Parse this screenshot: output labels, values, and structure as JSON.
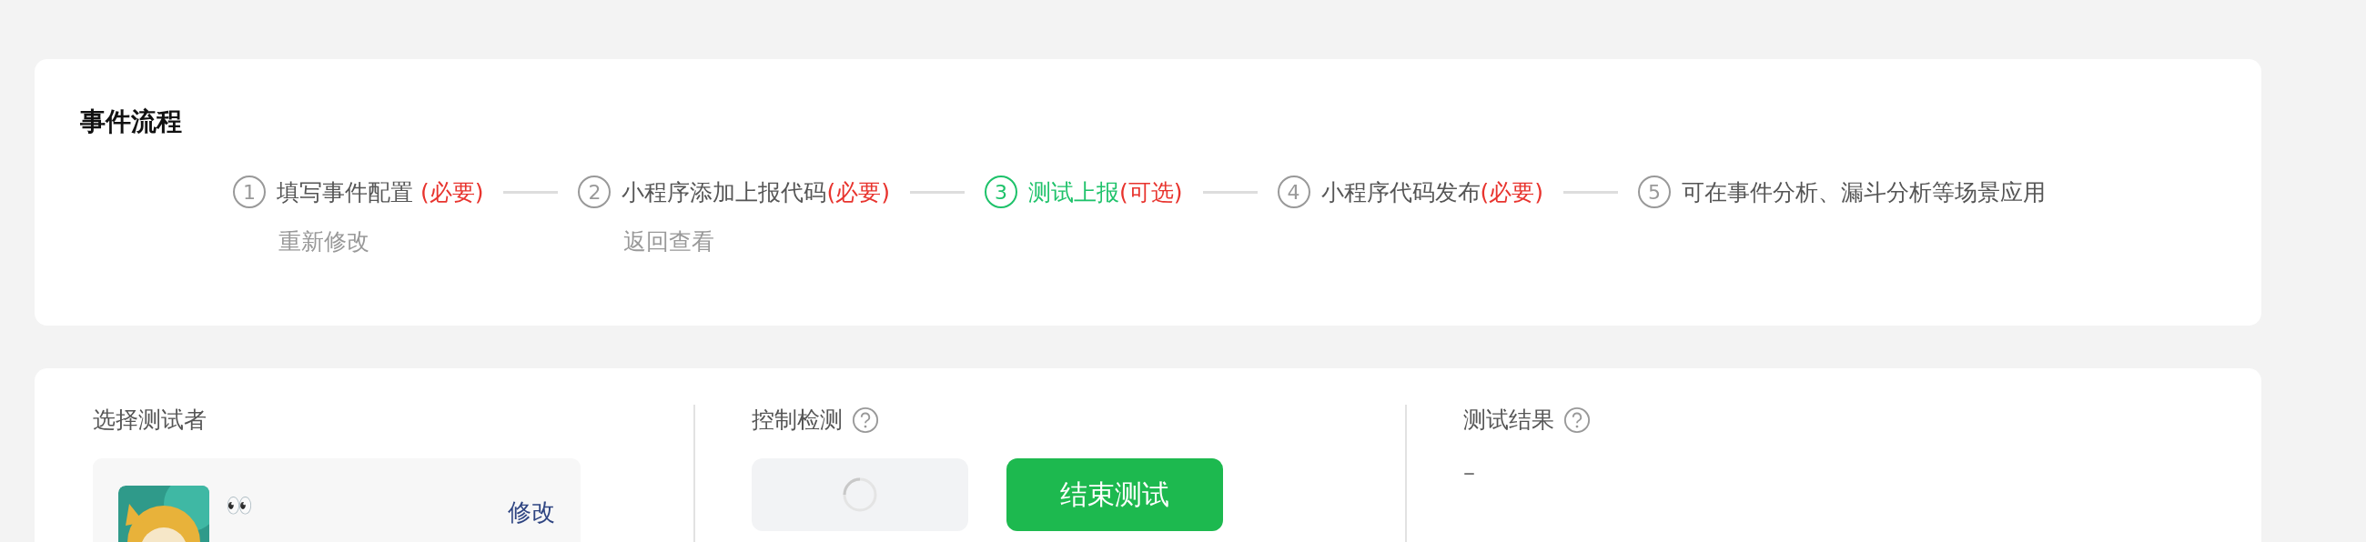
{
  "flow": {
    "title": "事件流程",
    "steps": [
      {
        "number": "1",
        "label": "填写事件配置 ",
        "tag": "(必要)",
        "selected": false,
        "link": "重新修改"
      },
      {
        "number": "2",
        "label": "小程序添加上报代码",
        "tag": "(必要)",
        "selected": false,
        "link": "返回查看"
      },
      {
        "number": "3",
        "label": "测试上报",
        "tag": "(可选)",
        "selected": true
      },
      {
        "number": "4",
        "label": "小程序代码发布",
        "tag": "(必要)",
        "selected": false
      },
      {
        "number": "5",
        "label": "可在事件分析、漏斗分析等场景应用",
        "selected": false
      }
    ]
  },
  "test": {
    "tester": {
      "title": "选择测试者",
      "name": "👀",
      "action": "修改"
    },
    "control": {
      "title": "控制检测",
      "button": "结束测试"
    },
    "result": {
      "title": "测试结果",
      "value": "–"
    }
  }
}
